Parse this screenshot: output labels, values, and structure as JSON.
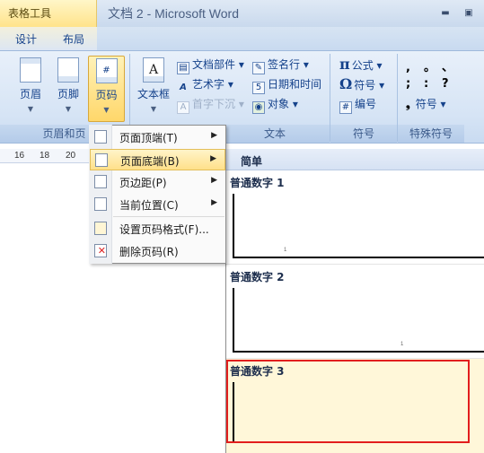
{
  "title_bar": {
    "context_tab_title": "表格工具",
    "doc_title": "文档 2 - Microsoft Word",
    "minimize_glyph": "▬",
    "restore_glyph": "▣"
  },
  "ribbon_tabs": [
    "设计",
    "布局"
  ],
  "groups": {
    "header_footer": {
      "label": "页眉和页",
      "buttons": {
        "header": "页眉",
        "footer": "页脚",
        "page_number": "页码"
      }
    },
    "text": {
      "label": "文本",
      "text_box": "文本框",
      "quick_parts": "文档部件",
      "wordart": "艺术字",
      "drop_cap": "首字下沉",
      "signature_line": "签名行",
      "date_time": "日期和时间",
      "object": "对象"
    },
    "symbols": {
      "label": "符号",
      "equation": "公式",
      "symbol": "符号",
      "numbering": "编号"
    },
    "special": {
      "label": "特殊符号",
      "glyph_row1": [
        ",",
        "。",
        "、"
      ],
      "glyph_row2": [
        ";",
        ":",
        "?"
      ],
      "symbol_label": "符号"
    }
  },
  "ruler": {
    "ticks": [
      "16",
      "18",
      "20"
    ]
  },
  "dropdown_menu": {
    "items": [
      {
        "label": "页面顶端(T)",
        "has_submenu": true
      },
      {
        "label": "页面底端(B)",
        "has_submenu": true
      },
      {
        "label": "页边距(P)",
        "has_submenu": true
      },
      {
        "label": "当前位置(C)",
        "has_submenu": true
      },
      {
        "label": "设置页码格式(F)...",
        "has_submenu": false
      },
      {
        "label": "删除页码(R)",
        "has_submenu": false
      }
    ],
    "highlighted_item": "页面底端(B)"
  },
  "gallery": {
    "header": "简单",
    "items": [
      {
        "title": "普通数字 1",
        "page_number": "1",
        "align": "left"
      },
      {
        "title": "普通数字 2",
        "page_number": "1",
        "align": "center"
      },
      {
        "title": "普通数字 3",
        "page_number": "",
        "align": "right"
      }
    ],
    "selected_item": "普通数字 3"
  },
  "colors": {
    "ribbon_text": "#15428b",
    "highlight": "#ffe08a",
    "selection_box": "#e21e1e"
  }
}
